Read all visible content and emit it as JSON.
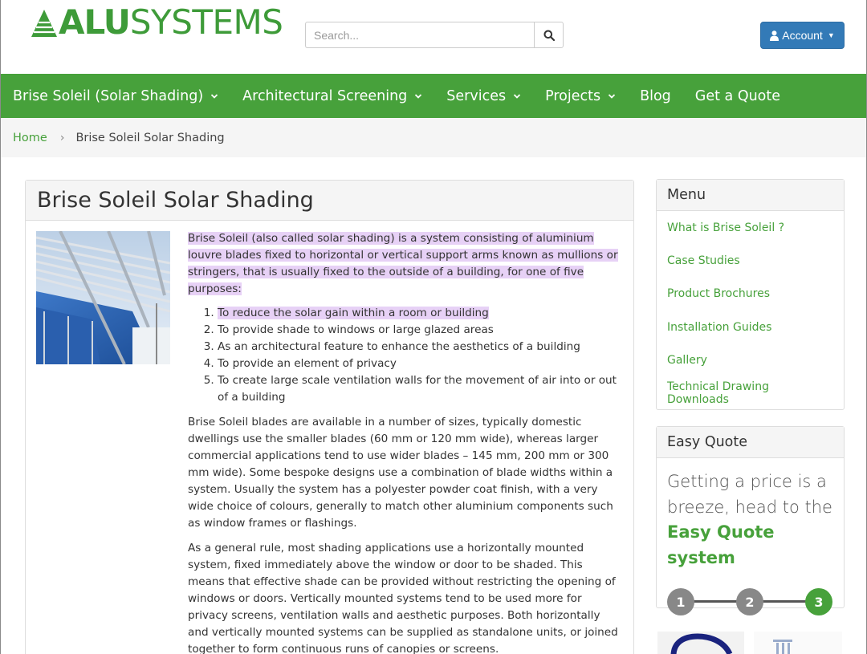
{
  "logo": {
    "bold": "ALU",
    "light": "SYSTEMS"
  },
  "search": {
    "placeholder": "Search..."
  },
  "account": {
    "label": "Account"
  },
  "nav": [
    {
      "label": "Brise Soleil (Solar Shading)",
      "dropdown": true
    },
    {
      "label": "Architectural Screening",
      "dropdown": true
    },
    {
      "label": "Services",
      "dropdown": true
    },
    {
      "label": "Projects",
      "dropdown": true
    },
    {
      "label": "Blog",
      "dropdown": false
    },
    {
      "label": "Get a Quote",
      "dropdown": false
    }
  ],
  "breadcrumb": {
    "home": "Home",
    "separator": "›",
    "current": "Brise Soleil Solar Shading"
  },
  "main": {
    "title": "Brise Soleil Solar Shading",
    "intro": "Brise Soleil (also called solar shading) is a system consisting of aluminium louvre blades fixed to horizontal or vertical support arms known as mullions or stringers, that is usually fixed to the outside of a building, for one of five purposes:",
    "purposes": [
      "To reduce the solar gain within a room or building",
      "To provide shade to windows or large glazed areas",
      "As an architectural feature to enhance the aesthetics of a building",
      "To provide an element of privacy",
      "To create large scale ventilation walls for the movement of air into or out of a building"
    ],
    "para1": "Brise Soleil blades are available in a number of sizes, typically domestic dwellings use the smaller blades (60 mm or 120 mm wide), whereas larger commercial applications tend to use wider blades – 145 mm, 200 mm or 300 mm wide). Some bespoke designs use a combination of blade widths within a system. Usually the system has a polyester powder coat finish, with a very wide choice of colours, generally to match other aluminium components such as window frames or flashings.",
    "para2": "As a general rule, most shading applications use a horizontally mounted system, fixed immediately above the window or door to be shaded. This means that effective shade can be provided without restricting the opening of windows or doors. Vertically mounted systems tend to be used more for privacy screens, ventilation walls and aesthetic purposes. Both horizontally and vertically mounted systems can be supplied as standalone units, or joined together to form continuous runs of canopies or screens."
  },
  "sidebar_menu": {
    "title": "Menu",
    "items": [
      "What is Brise Soleil ?",
      "Case Studies",
      "Product Brochures",
      "Installation Guides",
      "Gallery",
      "Technical Drawing Downloads"
    ]
  },
  "easy_quote": {
    "title": "Easy Quote",
    "text": "Getting a price is a breeze, head to the",
    "link": "Easy Quote system",
    "steps": [
      "1",
      "2",
      "3"
    ]
  },
  "colors": {
    "brand_green": "#47a13b",
    "account_blue": "#337ab7",
    "highlight": "#e7d1f6",
    "step_grey": "#888888"
  }
}
